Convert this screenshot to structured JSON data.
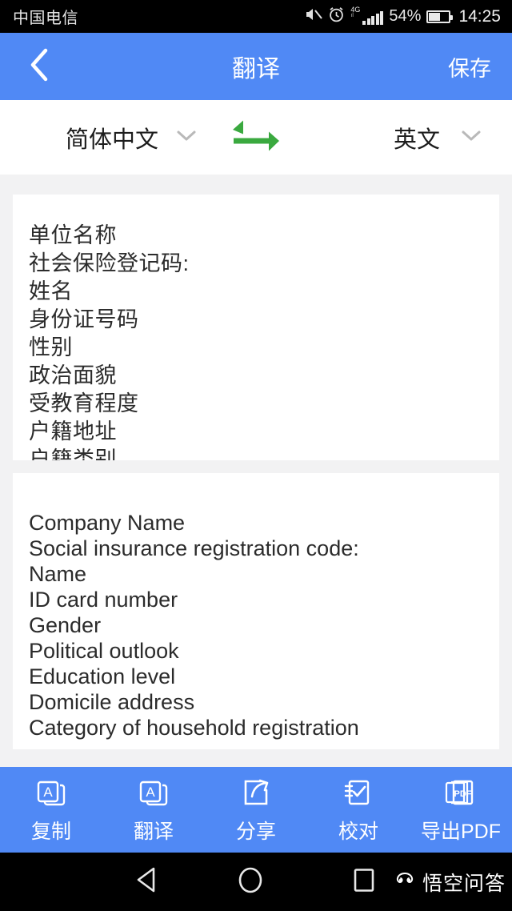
{
  "statusbar": {
    "carrier": "中国电信",
    "battery_percent": "54%",
    "time": "14:25",
    "network": "4G",
    "icons": [
      "mute-icon",
      "alarm-icon",
      "signal-icon",
      "battery-icon"
    ]
  },
  "appbar": {
    "back_icon": "chevron-left-icon",
    "title": "翻译",
    "save_label": "保存",
    "background": "#5089f5"
  },
  "language_bar": {
    "source_language": "简体中文",
    "target_language": "英文",
    "swap_icon": "swap-arrows-icon",
    "swap_color": "#3aa93f",
    "chevron_icon": "chevron-down-icon"
  },
  "source_text": {
    "lines": [
      "单位名称",
      "社会保险登记码:",
      "姓名",
      "身份证号码",
      "性别",
      "政治面貌",
      "受教育程度",
      "户籍地址",
      "户籍类别"
    ]
  },
  "target_text": {
    "lines": [
      "Company Name",
      "Social insurance registration code:",
      "Name",
      "ID card number",
      "Gender",
      "Political outlook",
      "Education level",
      "Domicile address",
      "Category of household registration"
    ]
  },
  "toolbar": {
    "items": [
      {
        "label": "复制",
        "icon": "copy-letter-a-icon"
      },
      {
        "label": "翻译",
        "icon": "translate-letter-a-icon"
      },
      {
        "label": "分享",
        "icon": "share-arrow-icon"
      },
      {
        "label": "校对",
        "icon": "proofread-check-icon"
      },
      {
        "label": "导出PDF",
        "icon": "export-pdf-icon"
      }
    ]
  },
  "navbar": {
    "back_icon": "nav-back-triangle-icon",
    "home_icon": "nav-home-circle-icon",
    "recent_icon": "nav-recents-square-icon",
    "watermark": "悟空问答"
  }
}
